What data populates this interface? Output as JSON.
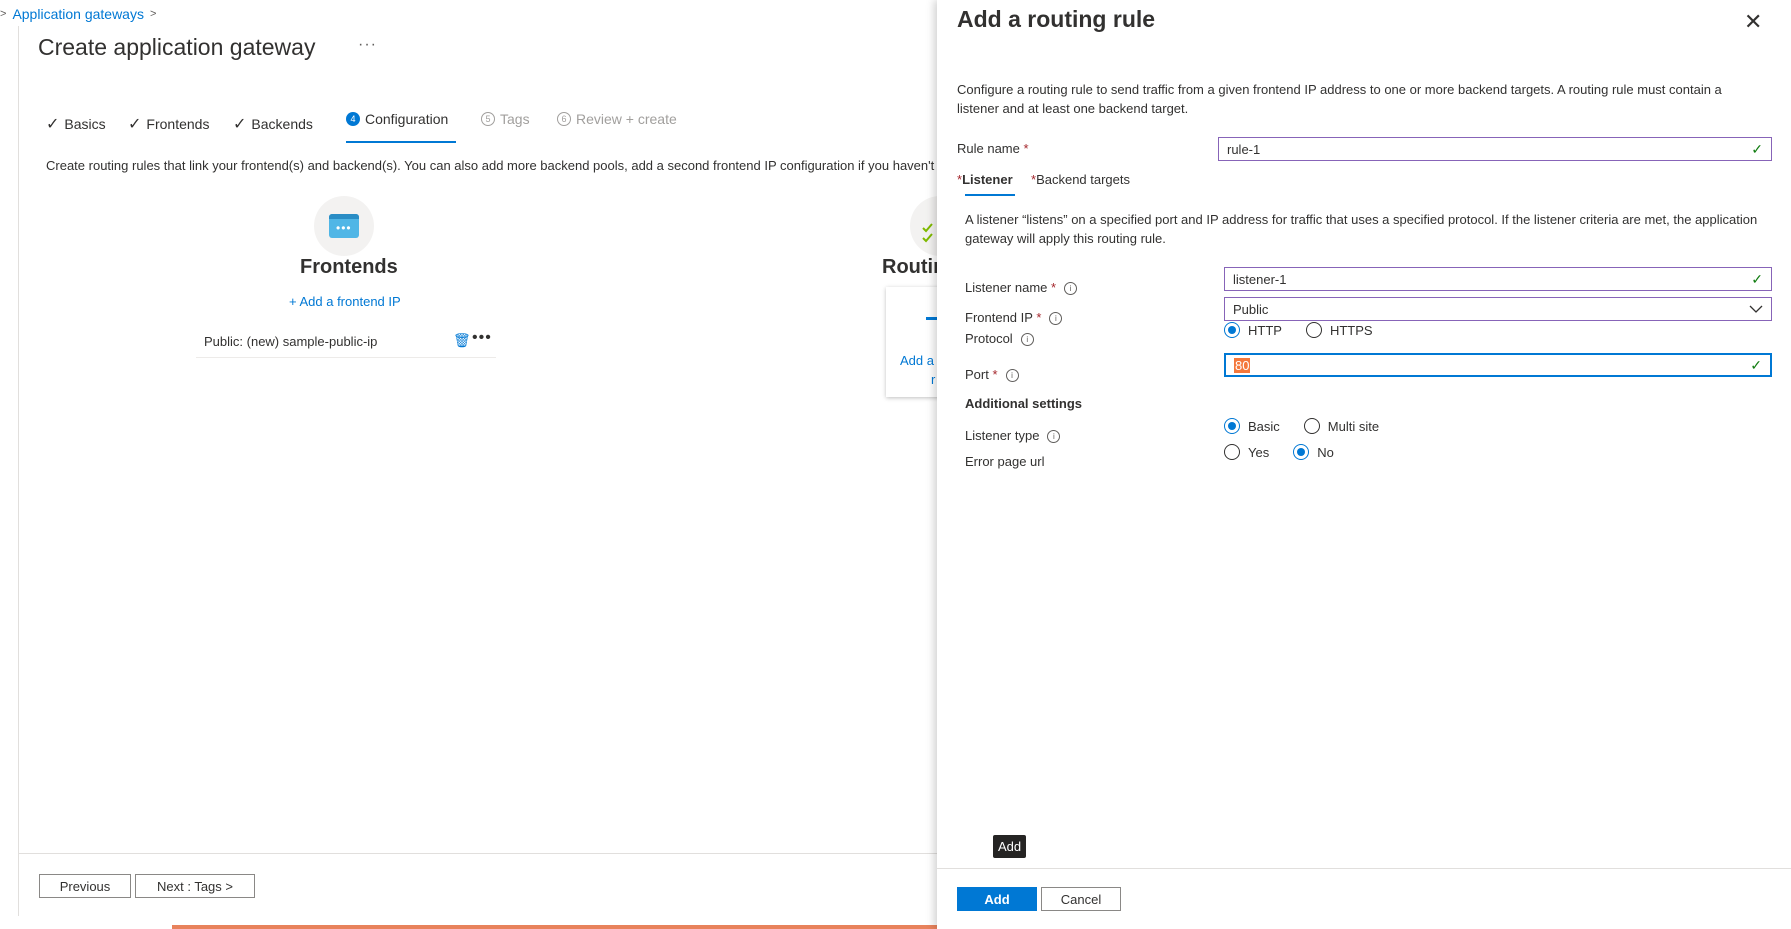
{
  "breadcrumb": {
    "chevron_left": ">",
    "item": "Application gateways",
    "chevron_right": ">"
  },
  "page": {
    "title": "Create application gateway",
    "ellipsis": "···",
    "steps": [
      {
        "label": "Basics",
        "state": "done"
      },
      {
        "label": "Frontends",
        "state": "done"
      },
      {
        "label": "Backends",
        "state": "done"
      },
      {
        "label": "Configuration",
        "state": "active",
        "number": "4"
      },
      {
        "label": "Tags",
        "state": "disabled",
        "number": "5"
      },
      {
        "label": "Review + create",
        "state": "disabled",
        "number": "6"
      }
    ],
    "description": "Create routing rules that link your frontend(s) and backend(s). You can also add more backend pools, add a second frontend IP configuration if you haven't",
    "frontends": {
      "heading": "Frontends",
      "add_link": "+ Add a frontend IP",
      "items": [
        {
          "label": "Public: (new) sample-public-ip"
        }
      ]
    },
    "routing": {
      "heading": "Routin",
      "card_text_line1": "Add a",
      "card_text_line2": "r"
    },
    "footer": {
      "previous": "Previous",
      "next": "Next : Tags >"
    }
  },
  "panel": {
    "title": "Add a routing rule",
    "description": "Configure a routing rule to send traffic from a given frontend IP address to one or more backend targets. A routing rule must contain a listener and at least one backend target.",
    "rule_name": {
      "label": "Rule name",
      "value": "rule-1"
    },
    "tabs": {
      "listener": "Listener",
      "backend_targets": "Backend targets"
    },
    "listener_desc": "A listener “listens” on a specified port and IP address for traffic that uses a specified protocol. If the listener criteria are met, the application gateway will apply this routing rule.",
    "listener_name": {
      "label": "Listener name",
      "value": "listener-1"
    },
    "frontend_ip": {
      "label": "Frontend IP",
      "value": "Public"
    },
    "protocol": {
      "label": "Protocol",
      "options": [
        "HTTP",
        "HTTPS"
      ],
      "selected": "HTTP"
    },
    "port": {
      "label": "Port",
      "value": "80"
    },
    "additional_settings": "Additional settings",
    "listener_type": {
      "label": "Listener type",
      "options": [
        "Basic",
        "Multi site"
      ],
      "selected": "Basic"
    },
    "error_page_url": {
      "label": "Error page url",
      "options": [
        "Yes",
        "No"
      ],
      "selected": "No"
    },
    "tooltip": "Add",
    "add_button": "Add",
    "cancel_button": "Cancel"
  },
  "colors": {
    "accent": "#0078d4",
    "valid": "#107c10",
    "required": "#a4262c",
    "focus_border": "#8764b8"
  }
}
